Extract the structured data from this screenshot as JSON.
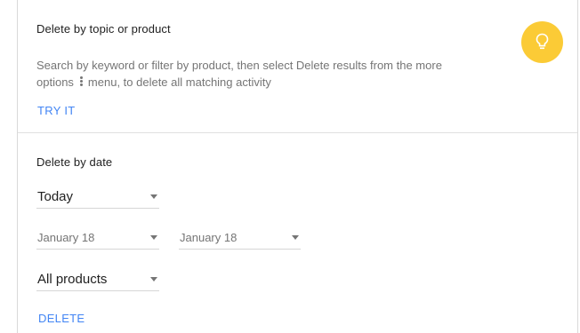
{
  "topic_section": {
    "title": "Delete by topic or product",
    "description_part1": "Search by keyword or filter by product, then select Delete results from the more",
    "description_part2_before": "options",
    "description_part2_after": "menu, to delete all matching activity",
    "try_it_label": "TRY IT",
    "bulb_color": "#fbcb36",
    "bulb_icon": "lightbulb-icon"
  },
  "date_section": {
    "title": "Delete by date",
    "range_select": "Today",
    "start_date": "January 18",
    "end_date": "January 18",
    "product_select": "All products",
    "delete_label": "DELETE"
  },
  "colors": {
    "link": "#4285f4",
    "divider": "#e0e0e0"
  }
}
